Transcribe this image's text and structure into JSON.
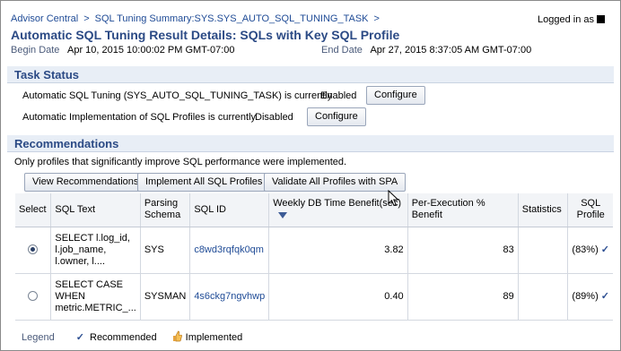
{
  "breadcrumb": {
    "items": [
      "Advisor Central",
      "SQL Tuning Summary:SYS.SYS_AUTO_SQL_TUNING_TASK"
    ],
    "separator": ">"
  },
  "header": {
    "logged_in_label": "Logged in as",
    "title": "Automatic SQL Tuning Result Details: SQLs with Key SQL Profile",
    "begin_date_label": "Begin Date",
    "begin_date_value": "Apr 10, 2015 10:00:02 PM GMT-07:00",
    "end_date_label": "End Date",
    "end_date_value": "Apr 27, 2015 8:37:05 AM GMT-07:00"
  },
  "task_status": {
    "heading": "Task Status",
    "rows": [
      {
        "label": "Automatic SQL Tuning (SYS_AUTO_SQL_TUNING_TASK) is currently",
        "value": "Enabled",
        "button": "Configure"
      },
      {
        "label": "Automatic Implementation of SQL Profiles is currently",
        "value": "Disabled",
        "button": "Configure"
      }
    ]
  },
  "recommendations": {
    "heading": "Recommendations",
    "note": "Only profiles that significantly improve SQL performance were implemented.",
    "buttons": {
      "view": "View Recommendations",
      "implement_all": "Implement All SQL Profiles",
      "validate_all": "Validate All Profiles with SPA"
    },
    "columns": {
      "select": "Select",
      "sql_text": "SQL Text",
      "parsing_schema": "Parsing Schema",
      "sql_id": "SQL ID",
      "weekly_benefit": "Weekly DB Time Benefit(sec)",
      "per_exec": "Per-Execution % Benefit",
      "statistics": "Statistics",
      "sql_profile": "SQL Profile"
    },
    "rows": [
      {
        "selected": true,
        "sql_text": "SELECT l.log_id, l.job_name, l.owner, l....",
        "schema": "SYS",
        "sql_id": "c8wd3rqfqk0qm",
        "weekly_benefit": "3.82",
        "per_exec": "83",
        "statistics": "",
        "sql_profile": "(83%)"
      },
      {
        "selected": false,
        "sql_text": "SELECT CASE WHEN metric.METRIC_...",
        "schema": "SYSMAN",
        "sql_id": "4s6ckg7ngvhwp",
        "weekly_benefit": "0.40",
        "per_exec": "89",
        "statistics": "",
        "sql_profile": "(89%)"
      }
    ]
  },
  "legend": {
    "label": "Legend",
    "recommended": "Recommended",
    "implemented": "Implemented"
  },
  "colors": {
    "heading": "#2b4a85",
    "link": "#1f4b96",
    "section_bg": "#e8eef6"
  }
}
